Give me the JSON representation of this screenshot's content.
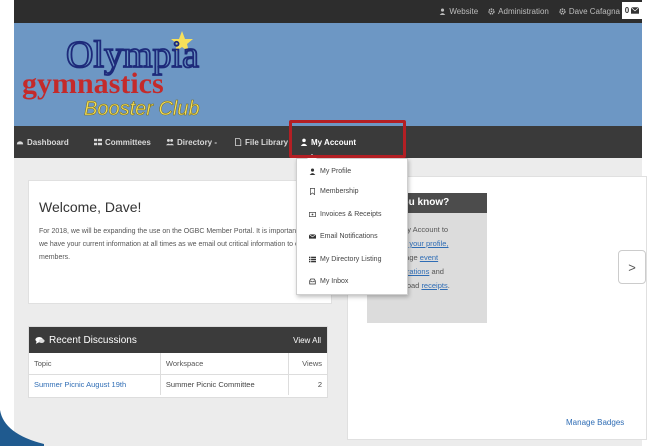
{
  "topbar": {
    "website": "Website",
    "administration": "Administration",
    "user": "Dave Cafagna",
    "message_count": "0"
  },
  "logo": {
    "line1": "Olympia",
    "line2": "gymnastics",
    "line3": "Booster Club"
  },
  "nav": {
    "dashboard": "Dashboard",
    "committees": "Committees",
    "directory": "Directory -",
    "file_library": "File Library",
    "my_account": "My Account"
  },
  "dropdown": {
    "items": [
      {
        "label": "My Profile",
        "icon": "user-icon"
      },
      {
        "label": "Membership",
        "icon": "bookmark-icon"
      },
      {
        "label": "Invoices & Receipts",
        "icon": "receipt-icon"
      },
      {
        "label": "Email Notifications",
        "icon": "envelope-icon"
      },
      {
        "label": "My Directory Listing",
        "icon": "list-icon"
      },
      {
        "label": "My Inbox",
        "icon": "inbox-icon"
      }
    ]
  },
  "welcome": {
    "title": "Welcome, Dave!",
    "body": "For 2018, we will be expanding the use on the OGBC Member Portal.  It is important that we have your current information at all times as we email out critical information to our members."
  },
  "did_you_know": {
    "title": "you know?",
    "line1": "My Account to",
    "link1": "te your profile,",
    "line2": "nage ",
    "link2": "event",
    "link3": "strations",
    "line3": " and",
    "line4": "nload ",
    "link4": "receipts",
    "line4_end": "."
  },
  "discussions": {
    "title": "Recent Discussions",
    "view_all": "View All",
    "columns": [
      "Topic",
      "Workspace",
      "Views"
    ],
    "rows": [
      {
        "topic": "Summer Picnic August 19th",
        "workspace": "Summer Picnic Committee",
        "views": "2"
      }
    ]
  },
  "arrow": ">",
  "manage_badges": "Manage Badges",
  "colors": {
    "banner": "#6d97c4",
    "nav": "#3a3a3a",
    "highlight": "#b31f24",
    "link": "#2f6db5"
  }
}
